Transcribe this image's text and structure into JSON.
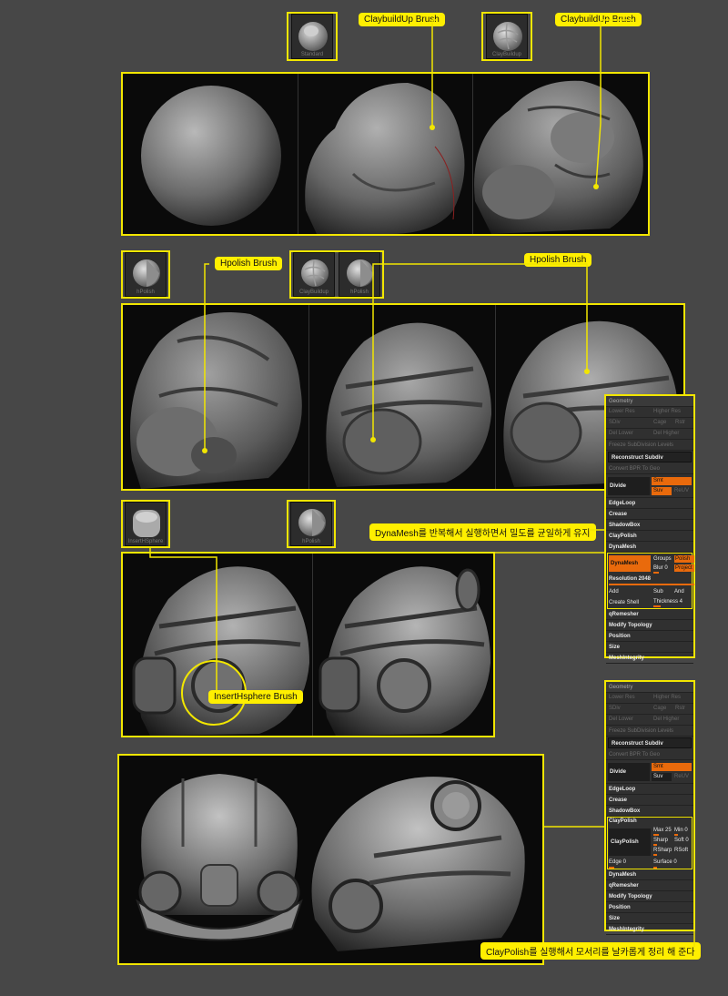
{
  "labels": {
    "claybuild1": "ClaybuildUp Brush",
    "claybuild2": "ClaybuildUp Brush",
    "hpolish1": "Hpolish Brush",
    "hpolish2": "Hpolish Brush",
    "dynamesh_note": "DynaMesh를 반복해서 실행하면서 밀도를 균일하게 유지",
    "inserthsphere": "InsertHsphere Brush",
    "claypolish_note": "ClayPolish를 실행해서 모서리를 날카롭게 정리 해 준다"
  },
  "thumbs": {
    "t1": "Standard",
    "t2": "ClayBuildup",
    "t3": "hPolish",
    "t4": "ClayBuildup",
    "t5": "hPolish",
    "t6": "InsertHSphere",
    "t7": "hPolish"
  },
  "panel1": {
    "title": "Geometry",
    "lower_res": "Lower Res",
    "higher_res": "Higher Res",
    "sdiv": "SDiv",
    "cage": "Cage",
    "rstr": "Rstr",
    "del_lower": "Del Lower",
    "del_higher": "Del Higher",
    "freeze": "Freeze SubDivision Levels",
    "reconstruct": "Reconstruct Subdiv",
    "convert": "Convert BPR To Geo",
    "divide": "Divide",
    "smt": "Smt",
    "suv": "Suv",
    "reuv": "ReUV",
    "edgeloop": "EdgeLoop",
    "crease": "Crease",
    "shadowbox": "ShadowBox",
    "claypolish": "ClayPolish",
    "dynamesh_hdr": "DynaMesh",
    "dynamesh_btn": "DynaMesh",
    "groups": "Groups",
    "polish": "Polish",
    "blur": "Blur 0",
    "project": "Project",
    "resolution": "Resolution 2048",
    "add": "Add",
    "sub": "Sub",
    "and": "And",
    "create_shell": "Create Shell",
    "thickness": "Thickness 4",
    "qremesher": "qRemesher",
    "modify_topology": "Modify Topology",
    "position": "Position",
    "size": "Size",
    "meshintegrity": "MeshIntegrity"
  },
  "panel2": {
    "title": "Geometry",
    "lower_res": "Lower Res",
    "higher_res": "Higher Res",
    "sdiv": "SDiv",
    "cage": "Cage",
    "rstr": "Rstr",
    "del_lower": "Del Lower",
    "del_higher": "Del Higher",
    "freeze": "Freeze SubDivision Levels",
    "reconstruct": "Reconstruct Subdiv",
    "convert": "Convert BPR To Geo",
    "divide": "Divide",
    "smt": "Smt",
    "suv": "Suv",
    "reuv": "ReUV",
    "edgeloop": "EdgeLoop",
    "crease": "Crease",
    "shadowbox": "ShadowBox",
    "claypolish_hdr": "ClayPolish",
    "claypolish_btn": "ClayPolish",
    "max": "Max 25",
    "min": "Min 0",
    "sharp": "Sharp",
    "soft": "Soft 0",
    "rsharp": "RSharp",
    "rsoft": "RSoft",
    "edge": "Edge 0",
    "surface": "Surface 0",
    "dynamesh": "DynaMesh",
    "qremesher": "qRemesher",
    "modify_topology": "Modify Topology",
    "position": "Position",
    "size": "Size",
    "meshintegrity": "MeshIntegrity"
  },
  "colors": {
    "accent": "#f2e600",
    "label_bg": "#ffef00",
    "zbrush_orange": "#e96a0c",
    "background": "#474747"
  }
}
